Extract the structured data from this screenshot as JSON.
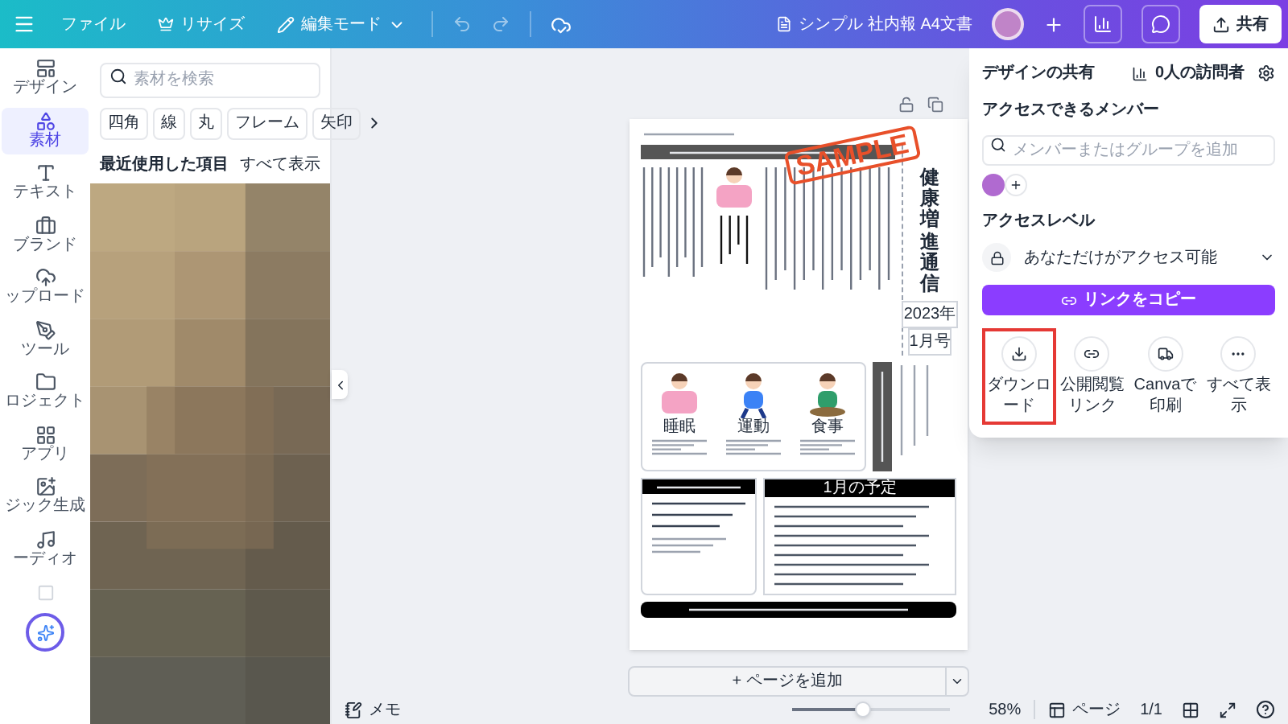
{
  "topbar": {
    "file": "ファイル",
    "resize": "リサイズ",
    "mode": "編集モード",
    "doc_title": "シンプル 社内報 A4文書",
    "share": "共有"
  },
  "rail": [
    {
      "label": "デザイン",
      "selected": false
    },
    {
      "label": "素材",
      "selected": true
    },
    {
      "label": "テキスト",
      "selected": false
    },
    {
      "label": "ブランド",
      "selected": false
    },
    {
      "label": "ップロード",
      "selected": false
    },
    {
      "label": "ツール",
      "selected": false
    },
    {
      "label": "ロジェクト",
      "selected": false
    },
    {
      "label": "アプリ",
      "selected": false
    },
    {
      "label": "ジック生成",
      "selected": false
    },
    {
      "label": "ーディオ",
      "selected": false
    }
  ],
  "panel": {
    "search": {
      "placeholder": "素材を検索"
    },
    "chips": [
      "四角",
      "線",
      "丸",
      "フレーム",
      "矢印"
    ],
    "recent": "最近使用した項目",
    "show_all": "すべて表示"
  },
  "document": {
    "stamp": "SAMPLE",
    "title": "健康増進通信",
    "year": "2023年",
    "issue": "1月号",
    "habits": [
      "睡眠",
      "運動",
      "食事"
    ],
    "schedule_title": "1月の予定"
  },
  "add_page": "+ ページを追加",
  "share_panel": {
    "title": "デザインの共有",
    "visitors": "0人の訪問者",
    "members_label": "アクセスできるメンバー",
    "member_search": {
      "placeholder": "メンバーまたはグループを追加"
    },
    "access_label": "アクセスレベル",
    "access_value": "あなただけがアクセス可能",
    "copy_link": "リンクをコピー",
    "actions": [
      {
        "label": "ダウンロード",
        "kind": "download",
        "highlighted": true
      },
      {
        "label": "公開閲覧リンク",
        "kind": "link",
        "highlighted": false
      },
      {
        "label": "Canvaで印刷",
        "kind": "print",
        "highlighted": false
      },
      {
        "label": "すべて表示",
        "kind": "more",
        "highlighted": false
      }
    ]
  },
  "bottombar": {
    "notes": "メモ",
    "zoom": {
      "level": 0.45
    },
    "zoom_reading": "58%",
    "pages": "ページ",
    "page_count": "1/1"
  }
}
